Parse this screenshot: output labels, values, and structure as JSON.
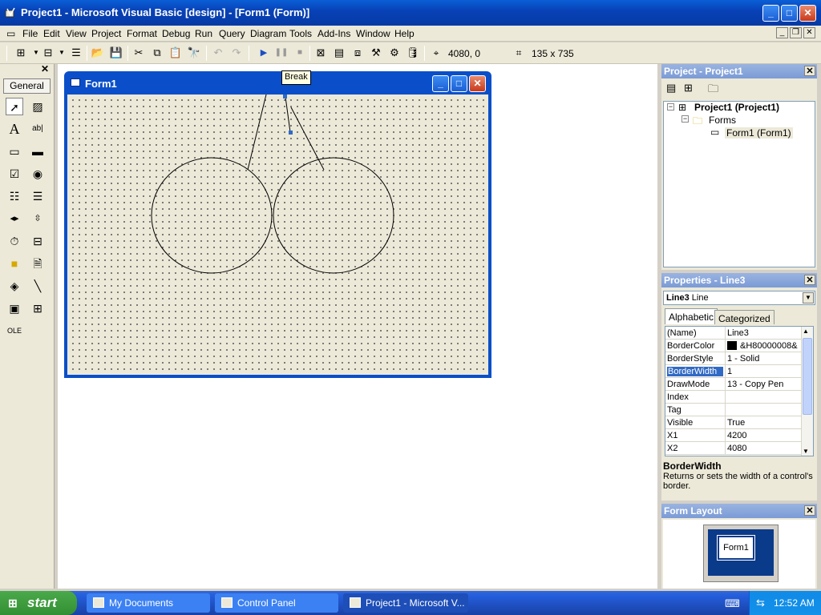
{
  "window": {
    "title": "Project1 - Microsoft Visual Basic [design] - [Form1 (Form)]"
  },
  "menu": [
    "File",
    "Edit",
    "View",
    "Project",
    "Format",
    "Debug",
    "Run",
    "Query",
    "Diagram",
    "Tools",
    "Add-Ins",
    "Window",
    "Help"
  ],
  "toolbar": {
    "position_readout": "4080, 0",
    "size_readout": "135 x 735",
    "tooltip": "Break"
  },
  "toolbox": {
    "tab_label": "General",
    "tools": [
      "pointer-icon",
      "picturebox-icon",
      "label-icon",
      "textbox-icon",
      "frame-icon",
      "commandbutton-icon",
      "checkbox-icon",
      "optionbutton-icon",
      "combobox-icon",
      "listbox-icon",
      "hscrollbar-icon",
      "vscrollbar-icon",
      "timer-icon",
      "drivelistbox-icon",
      "dirlistbox-icon",
      "filelistbox-icon",
      "shape-icon",
      "line-icon",
      "image-icon",
      "data-icon",
      "ole-icon"
    ]
  },
  "form": {
    "title": "Form1"
  },
  "project_pane": {
    "title": "Project - Project1",
    "root": "Project1 (Project1)",
    "folder": "Forms",
    "item": "Form1 (Form1)"
  },
  "properties_pane": {
    "title": "Properties - Line3",
    "object_name": "Line3",
    "object_type": "Line",
    "tabs": [
      "Alphabetic",
      "Categorized"
    ],
    "rows": [
      {
        "name": "(Name)",
        "value": "Line3"
      },
      {
        "name": "BorderColor",
        "value": "&H80000008&"
      },
      {
        "name": "BorderStyle",
        "value": "1 - Solid"
      },
      {
        "name": "BorderWidth",
        "value": "1"
      },
      {
        "name": "DrawMode",
        "value": "13 - Copy Pen"
      },
      {
        "name": "Index",
        "value": ""
      },
      {
        "name": "Tag",
        "value": ""
      },
      {
        "name": "Visible",
        "value": "True"
      },
      {
        "name": "X1",
        "value": "4200"
      },
      {
        "name": "X2",
        "value": "4080"
      }
    ],
    "selected_property": "BorderWidth",
    "description_title": "BorderWidth",
    "description_text": "Returns or sets the width of a control's border."
  },
  "layout_pane": {
    "title": "Form Layout",
    "form_label": "Form1"
  },
  "taskbar": {
    "start_label": "start",
    "tasks": [
      "My Documents",
      "Control Panel",
      "Project1 - Microsoft V..."
    ],
    "clock": "12:52 AM"
  },
  "colors": {
    "title_blue": "#0842b8",
    "selection_blue": "#316ac5",
    "start_green": "#338f33"
  }
}
